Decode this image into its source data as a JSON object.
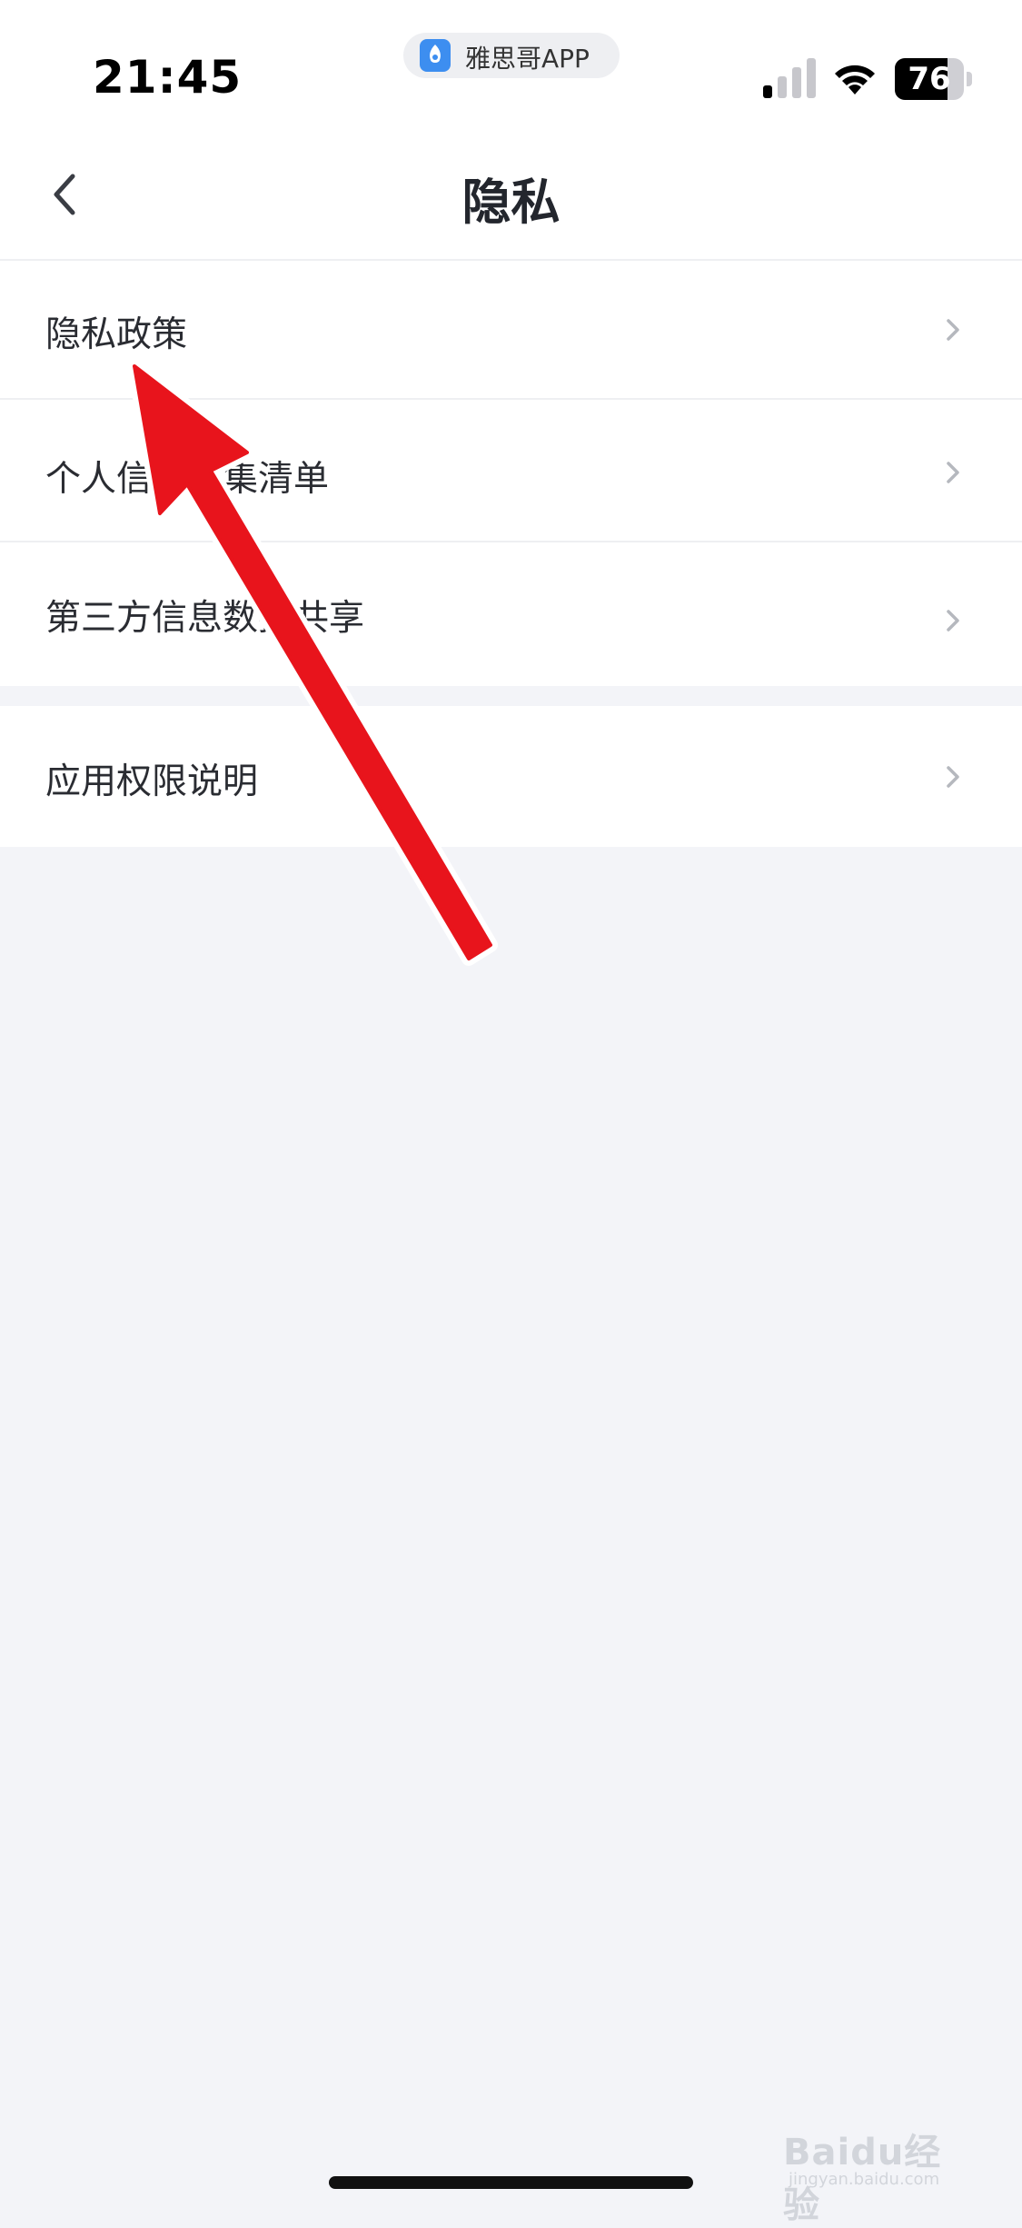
{
  "status_bar": {
    "time": "21:45",
    "app_name": "雅思哥APP",
    "battery_percent": "76",
    "battery_level": 0.76,
    "icons": [
      "app-logo-icon",
      "signal-icon",
      "wifi-icon",
      "battery-icon"
    ]
  },
  "header": {
    "title": "隐私",
    "back_icon": "chevron-left-icon"
  },
  "groups": [
    {
      "items": [
        {
          "label": "隐私政策",
          "icon": "chevron-right-icon"
        },
        {
          "label": "个人信息收集清单",
          "icon": "chevron-right-icon"
        },
        {
          "label": "第三方信息数据共享",
          "icon": "chevron-right-icon"
        }
      ]
    },
    {
      "items": [
        {
          "label": "应用权限说明",
          "icon": "chevron-right-icon"
        }
      ]
    }
  ],
  "annotation": {
    "type": "arrow",
    "color": "#e8141c",
    "points_to": "隐私政策"
  },
  "watermark": {
    "brand": "Baidu经验",
    "sub": "jingyan.baidu.com"
  },
  "colors": {
    "background": "#f3f4f8",
    "surface": "#ffffff",
    "text": "#2a2c32",
    "chevron": "#b5b8be",
    "arrow": "#e8141c"
  }
}
